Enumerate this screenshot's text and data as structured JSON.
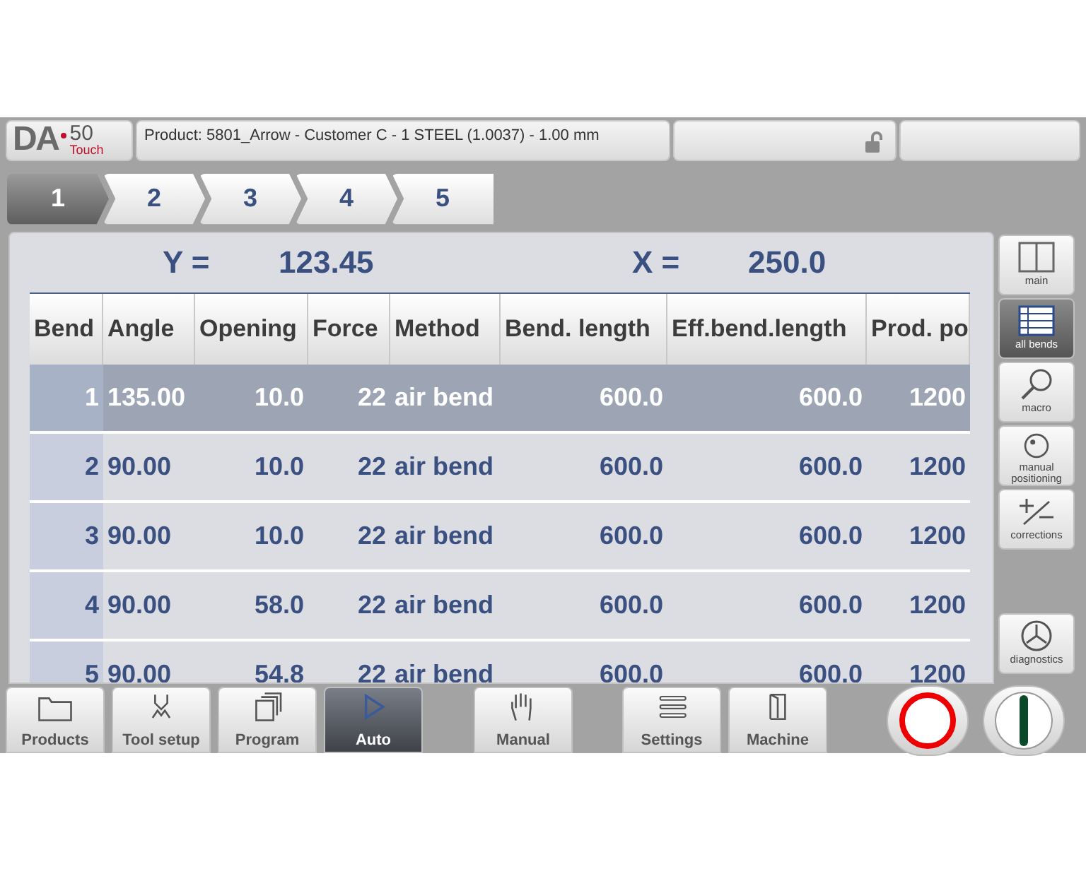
{
  "header": {
    "logo": {
      "brand": "DA",
      "model": "50",
      "edition": "Touch"
    },
    "product": "Product: 5801_Arrow - Customer C - 1 STEEL (1.0037) - 1.00 mm",
    "locked": false
  },
  "tabs": [
    {
      "label": "1",
      "selected": true
    },
    {
      "label": "2",
      "selected": false
    },
    {
      "label": "3",
      "selected": false
    },
    {
      "label": "4",
      "selected": false
    },
    {
      "label": "5",
      "selected": false
    }
  ],
  "axes": [
    {
      "label": "Y =",
      "value": "123.45"
    },
    {
      "label": "X =",
      "value": "250.0"
    }
  ],
  "table": {
    "columns": [
      "Bend",
      "Angle",
      "Opening",
      "Force",
      "Method",
      "Bend. length",
      "Eff.bend.length",
      "Prod. po"
    ],
    "rows": [
      {
        "selected": true,
        "cells": [
          "1",
          "135.00",
          "10.0",
          "22",
          "air bend",
          "600.0",
          "600.0",
          "1200"
        ]
      },
      {
        "selected": false,
        "cells": [
          "2",
          "90.00",
          "10.0",
          "22",
          "air bend",
          "600.0",
          "600.0",
          "1200"
        ]
      },
      {
        "selected": false,
        "cells": [
          "3",
          "90.00",
          "10.0",
          "22",
          "air bend",
          "600.0",
          "600.0",
          "1200"
        ]
      },
      {
        "selected": false,
        "cells": [
          "4",
          "90.00",
          "58.0",
          "22",
          "air bend",
          "600.0",
          "600.0",
          "1200"
        ]
      },
      {
        "selected": false,
        "cells": [
          "5",
          "90.00",
          "54.8",
          "22",
          "air bend",
          "600.0",
          "600.0",
          "1200"
        ]
      }
    ]
  },
  "side_buttons": [
    {
      "kind": "main",
      "label": "main",
      "selected": false
    },
    {
      "kind": "grid",
      "label": "all bends",
      "selected": true
    },
    {
      "kind": "zoom",
      "label": "macro",
      "selected": false
    },
    {
      "kind": "dial",
      "label": "manual positioning",
      "selected": false
    },
    {
      "kind": "plusminus",
      "label": "corrections",
      "selected": false
    },
    {
      "kind": "gauge",
      "label": "diagnostics",
      "selected": false
    }
  ],
  "nav": [
    {
      "kind": "folder",
      "label": "Products",
      "selected": false
    },
    {
      "kind": "tool",
      "label": "Tool setup",
      "selected": false
    },
    {
      "kind": "pages",
      "label": "Program",
      "selected": false
    },
    {
      "kind": "play",
      "label": "Auto",
      "selected": true
    },
    {
      "kind": "hand",
      "label": "Manual",
      "selected": false
    },
    {
      "kind": "list",
      "label": "Settings",
      "selected": false
    },
    {
      "kind": "door",
      "label": "Machine",
      "selected": false
    }
  ]
}
